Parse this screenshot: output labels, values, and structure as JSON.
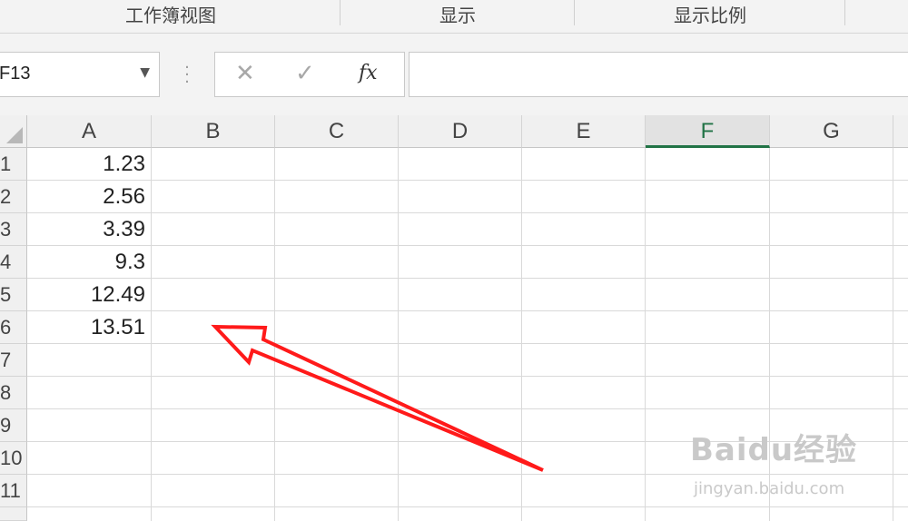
{
  "ribbon": {
    "groups": [
      {
        "label": "工作簿视图"
      },
      {
        "label": "显示"
      },
      {
        "label": "显示比例"
      }
    ]
  },
  "formula_bar": {
    "name_box_value": "F13",
    "cancel_icon": "close-icon",
    "confirm_icon": "check-icon",
    "fx_label": "fx",
    "formula_value": ""
  },
  "sheet": {
    "columns": [
      "A",
      "B",
      "C",
      "D",
      "E",
      "F",
      "G"
    ],
    "selected_column": "F",
    "rows": [
      "1",
      "2",
      "3",
      "4",
      "5",
      "6",
      "7",
      "8",
      "9",
      "10",
      "11"
    ],
    "column_a_values": [
      "1.23",
      "2.56",
      "3.39",
      "9.3",
      "12.49",
      "13.51"
    ]
  },
  "annotation": {
    "arrow_color": "#ff1a1a"
  },
  "watermark": {
    "brand": "Baidu经验",
    "url": "jingyan.baidu.com"
  },
  "colors": {
    "accent": "#217346",
    "ribbon_bg": "#f3f3f3",
    "grid_line": "#d9d9d9"
  }
}
